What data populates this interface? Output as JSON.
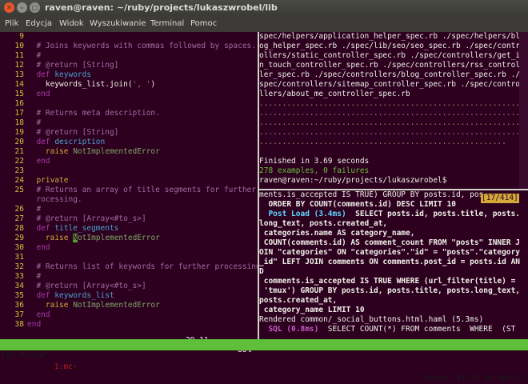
{
  "window": {
    "title": "raven@raven: ~/ruby/projects/lukaszwrobel/lib",
    "menu": [
      "Plik",
      "Edycja",
      "Widok",
      "Wyszukiwanie",
      "Terminal",
      "Pomoc"
    ]
  },
  "vim": {
    "lines": [
      {
        "n": "9",
        "parts": [
          {
            "t": ""
          }
        ]
      },
      {
        "n": "10",
        "parts": [
          {
            "t": "  # Joins keywords with commas followed by spaces.",
            "c": "c"
          }
        ]
      },
      {
        "n": "11",
        "parts": [
          {
            "t": "  #",
            "c": "c"
          }
        ]
      },
      {
        "n": "12",
        "parts": [
          {
            "t": "  # @return [String]",
            "c": "c"
          }
        ]
      },
      {
        "n": "13",
        "parts": [
          {
            "t": "  def ",
            "c": "k"
          },
          {
            "t": "keywords",
            "c": "f"
          }
        ]
      },
      {
        "n": "14",
        "parts": [
          {
            "t": "    keywords_list.join(",
            "c": "p"
          },
          {
            "t": "', '",
            "c": "s"
          },
          {
            "t": ")",
            "c": "p"
          }
        ]
      },
      {
        "n": "15",
        "parts": [
          {
            "t": "  end",
            "c": "k"
          }
        ]
      },
      {
        "n": "16",
        "parts": [
          {
            "t": ""
          }
        ]
      },
      {
        "n": "17",
        "parts": [
          {
            "t": "  # Returns meta description.",
            "c": "c"
          }
        ]
      },
      {
        "n": "18",
        "parts": [
          {
            "t": "  #",
            "c": "c"
          }
        ]
      },
      {
        "n": "19",
        "parts": [
          {
            "t": "  # @return [String]",
            "c": "c"
          }
        ]
      },
      {
        "n": "20",
        "parts": [
          {
            "t": "  def ",
            "c": "k"
          },
          {
            "t": "description",
            "c": "f"
          }
        ]
      },
      {
        "n": "21",
        "parts": [
          {
            "t": "    raise ",
            "c": "e"
          },
          {
            "t": "NotImplementedError",
            "c": "t"
          }
        ]
      },
      {
        "n": "22",
        "parts": [
          {
            "t": "  end",
            "c": "k"
          }
        ]
      },
      {
        "n": "23",
        "parts": [
          {
            "t": ""
          }
        ]
      },
      {
        "n": "24",
        "parts": [
          {
            "t": "  private",
            "c": "e"
          }
        ]
      },
      {
        "n": "25",
        "parts": [
          {
            "t": "  # Returns an array of title segments for further p",
            "c": "c"
          }
        ]
      },
      {
        "n": "",
        "parts": [
          {
            "t": "  rocessing.",
            "c": "c"
          }
        ]
      },
      {
        "n": "26",
        "parts": [
          {
            "t": "  #",
            "c": "c"
          }
        ]
      },
      {
        "n": "27",
        "parts": [
          {
            "t": "  # @return [Array<#to_s>]",
            "c": "c"
          }
        ]
      },
      {
        "n": "28",
        "parts": [
          {
            "t": "  def ",
            "c": "k"
          },
          {
            "t": "title_segments",
            "c": "f"
          }
        ]
      },
      {
        "n": "29",
        "parts": [
          {
            "t": "    raise ",
            "c": "e"
          },
          {
            "t": "N",
            "c": "cursorchar"
          },
          {
            "t": "otImplementedError",
            "c": "t"
          }
        ]
      },
      {
        "n": "30",
        "parts": [
          {
            "t": "  end",
            "c": "k"
          }
        ]
      },
      {
        "n": "31",
        "parts": [
          {
            "t": ""
          }
        ]
      },
      {
        "n": "32",
        "parts": [
          {
            "t": "  # Returns list of keywords for further processing.",
            "c": "c"
          }
        ]
      },
      {
        "n": "33",
        "parts": [
          {
            "t": "  #",
            "c": "c"
          }
        ]
      },
      {
        "n": "34",
        "parts": [
          {
            "t": "  # @return [Array<#to_s>]",
            "c": "c"
          }
        ]
      },
      {
        "n": "35",
        "parts": [
          {
            "t": "  def ",
            "c": "k"
          },
          {
            "t": "keywords_list",
            "c": "f"
          }
        ]
      },
      {
        "n": "36",
        "parts": [
          {
            "t": "    raise ",
            "c": "e"
          },
          {
            "t": "NotImplementedError",
            "c": "t"
          }
        ]
      },
      {
        "n": "37",
        "parts": [
          {
            "t": "  end",
            "c": "k"
          }
        ]
      },
      {
        "n": "38",
        "parts": [
          {
            "t": "end",
            "c": "k"
          }
        ]
      }
    ],
    "status_position": "29,11",
    "status_percent": "88%"
  },
  "terminal_top": {
    "lines": [
      {
        "parts": [
          {
            "t": "spec/helpers/application_helper_spec.rb ./spec/helpers/bl"
          }
        ]
      },
      {
        "parts": [
          {
            "t": "og_helper_spec.rb ./spec/lib/seo/seo_spec.rb ./spec/contr"
          }
        ]
      },
      {
        "parts": [
          {
            "t": "ollers/static_controller_spec.rb ./spec/controllers/get_i"
          }
        ]
      },
      {
        "parts": [
          {
            "t": "n_touch_controller_spec.rb ./spec/controllers/rss_control"
          }
        ]
      },
      {
        "parts": [
          {
            "t": "ler_spec.rb ./spec/controllers/blog_controller_spec.rb ./"
          }
        ]
      },
      {
        "parts": [
          {
            "t": "spec/controllers/sitemap_controller_spec.rb ./spec/contro"
          }
        ]
      },
      {
        "parts": [
          {
            "t": "llers/about_me_controller_spec.rb"
          }
        ]
      },
      {
        "parts": [
          {
            "t": "..........................................................",
            "c": "dots"
          }
        ]
      },
      {
        "parts": [
          {
            "t": "..........................................................",
            "c": "dots"
          }
        ]
      },
      {
        "parts": [
          {
            "t": "..........................................................",
            "c": "dots"
          }
        ]
      },
      {
        "parts": [
          {
            "t": "..........................................................",
            "c": "dots"
          }
        ]
      },
      {
        "parts": [
          {
            "t": "......................................................",
            "c": "dots"
          }
        ]
      },
      {
        "parts": [
          {
            "t": ""
          }
        ]
      },
      {
        "parts": [
          {
            "t": "Finished in 3.69 seconds"
          }
        ]
      },
      {
        "parts": [
          {
            "t": "278 examples, 0 failures",
            "c": "green"
          }
        ]
      },
      {
        "parts": [
          {
            "t": "raven@raven:~/ruby/projects/lukaszwrobel$ "
          }
        ]
      }
    ]
  },
  "terminal_bottom": {
    "counter": "[17/414]",
    "lines": [
      {
        "parts": [
          {
            "t": "ments.is_accepted IS TRUE) GROUP BY posts.id, pos"
          }
        ]
      },
      {
        "parts": [
          {
            "t": "  ORDER BY COUNT(comments.id) DESC LIMIT 10",
            "c": "bold"
          }
        ]
      },
      {
        "parts": [
          {
            "t": "  Post Load (3.4ms)",
            "c": "cyan bold"
          },
          {
            "t": "  SELECT posts.id, posts.title, posts.",
            "c": "bold"
          }
        ]
      },
      {
        "parts": [
          {
            "t": "long_text, posts.created_at,",
            "c": "bold"
          }
        ]
      },
      {
        "parts": [
          {
            "t": " categories.name AS category_name,",
            "c": "bold"
          }
        ]
      },
      {
        "parts": [
          {
            "t": " COUNT(comments.id) AS comment_count FROM \"posts\" INNER J",
            "c": "bold"
          }
        ]
      },
      {
        "parts": [
          {
            "t": "OIN \"categories\" ON \"categories\".\"id\" = \"posts\".\"category",
            "c": "bold"
          }
        ]
      },
      {
        "parts": [
          {
            "t": "_id\" LEFT JOIN comments ON comments.post_id = posts.id AN",
            "c": "bold"
          }
        ]
      },
      {
        "parts": [
          {
            "t": "D",
            "c": "bold"
          }
        ]
      },
      {
        "parts": [
          {
            "t": " comments.is_accepted IS TRUE WHERE (url_filter(title) =",
            "c": "bold"
          }
        ]
      },
      {
        "parts": [
          {
            "t": " 'tmux') GROUP BY posts.id, posts.title, posts.long_text,",
            "c": "bold"
          }
        ]
      },
      {
        "parts": [
          {
            "t": "posts.created_at,",
            "c": "bold"
          }
        ]
      },
      {
        "parts": [
          {
            "t": " category_name LIMIT 10",
            "c": "bold"
          }
        ]
      },
      {
        "parts": [
          {
            "t": "Rendered common/_social_buttons.html.haml (5.3ms)"
          }
        ]
      },
      {
        "parts": [
          {
            "t": "  SQL (0.8ms)",
            "c": "mag bold"
          },
          {
            "t": "  SELECT COUNT(*) FROM comments  WHERE  (ST"
          }
        ]
      }
    ]
  },
  "tmux": {
    "win0": "[0] 0:vim*",
    "win1": "1:mc-",
    "right": "\"raven\" 14:31 30-Apr-12"
  }
}
